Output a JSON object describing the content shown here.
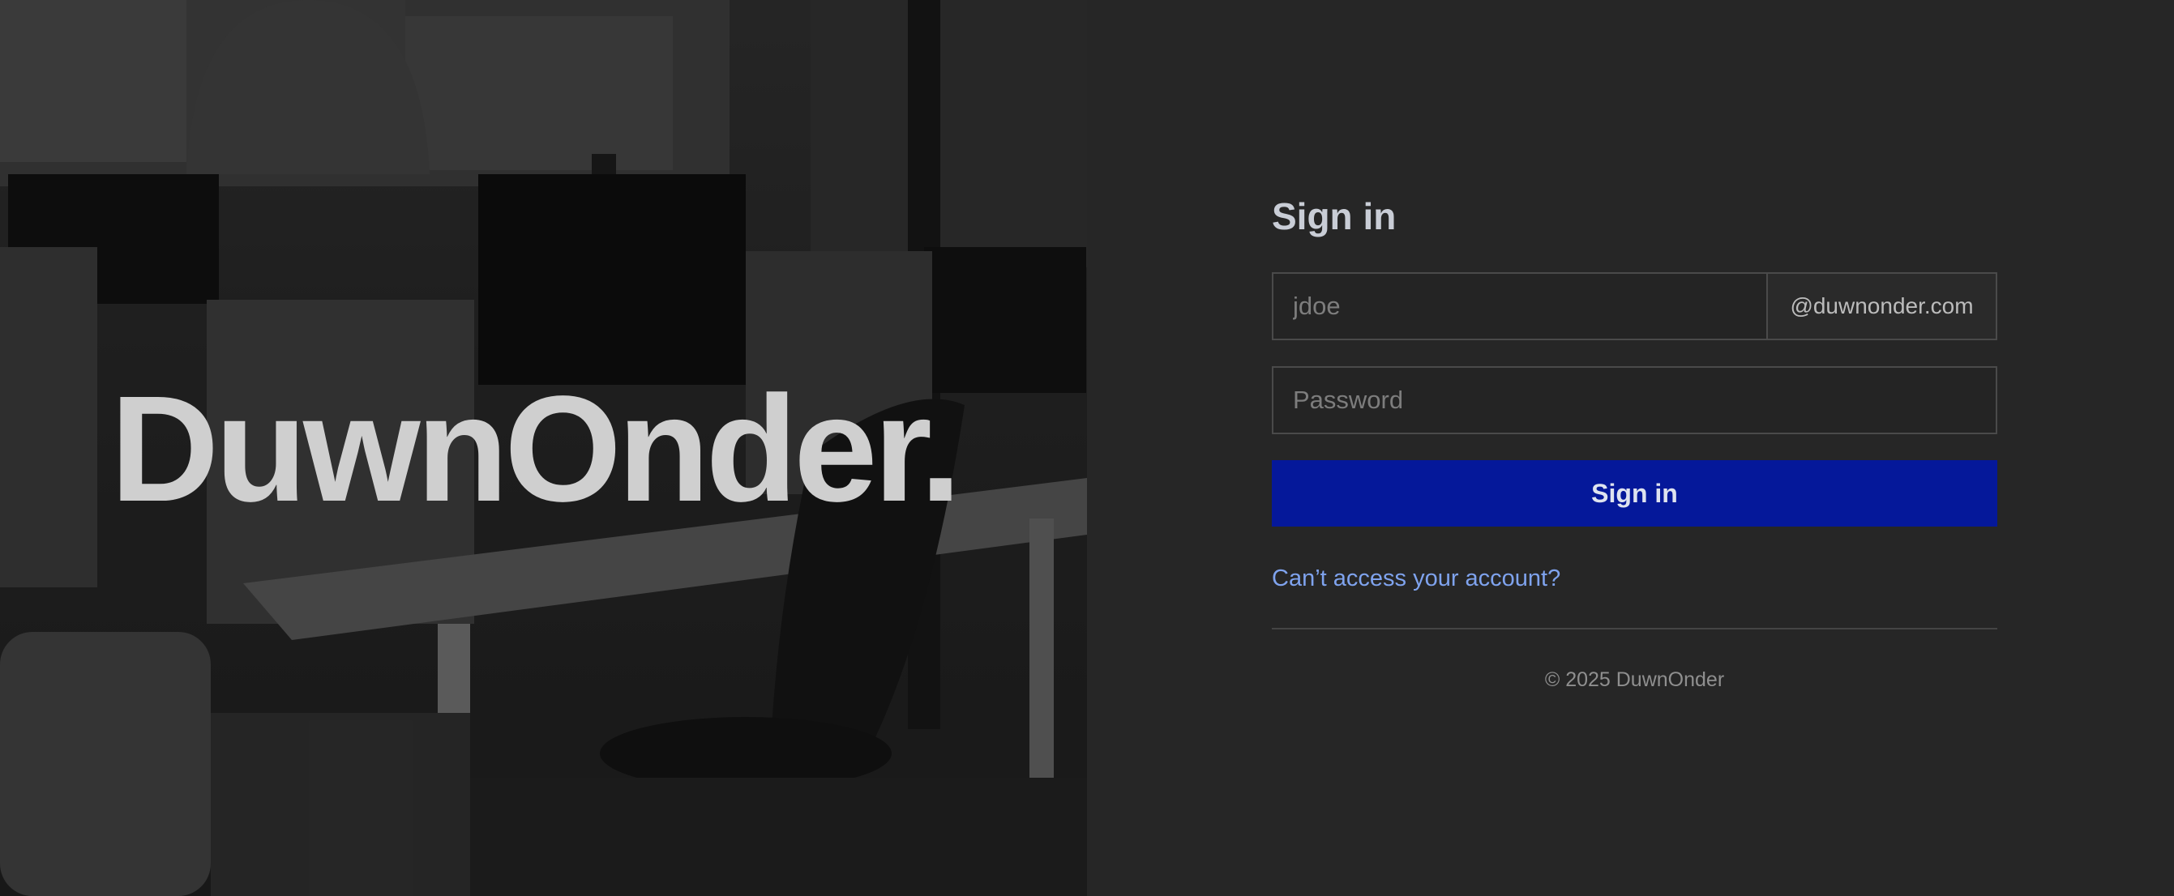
{
  "brand": {
    "name": "DuwnOnder."
  },
  "signin": {
    "title": "Sign in",
    "username_placeholder": "jdoe",
    "username_value": "",
    "domain_suffix": "@duwnonder.com",
    "password_placeholder": "Password",
    "password_value": "",
    "submit_label": "Sign in",
    "forgot_link": "Can’t access your account?"
  },
  "footer": {
    "copyright": "© 2025 DuwnOnder"
  },
  "colors": {
    "background": "#262626",
    "primary_button": "#05189a",
    "link": "#7fa3ee",
    "brand_text": "#cfcfcf"
  }
}
